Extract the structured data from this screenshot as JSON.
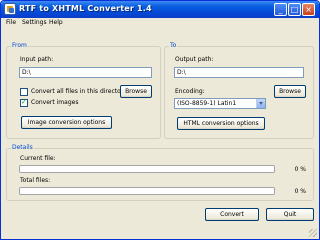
{
  "window": {
    "title": "RTF to XHTML Converter 1.4"
  },
  "menu": [
    "File",
    "Settings",
    "Help"
  ],
  "from": {
    "legend": "From",
    "input_label": "Input path:",
    "input_value": "D:\\",
    "convert_all_label": "Convert all files in this directory",
    "convert_all_checked": false,
    "convert_images_label": "Convert images",
    "convert_images_checked": true,
    "browse_label": "Browse",
    "image_options_label": "Image conversion options"
  },
  "to": {
    "legend": "To",
    "output_label": "Output path:",
    "output_value": "D:\\",
    "browse_label": "Browse",
    "encoding_label": "Encoding:",
    "encoding_value": "(ISO-8859-1) Latin1",
    "html_options_label": "HTML conversion options"
  },
  "details": {
    "legend": "Details",
    "current_label": "Current file:",
    "current_percent": "0 %",
    "total_label": "Total files:",
    "total_percent": "0 %"
  },
  "footer": {
    "convert_label": "Convert",
    "quit_label": "Quit"
  }
}
